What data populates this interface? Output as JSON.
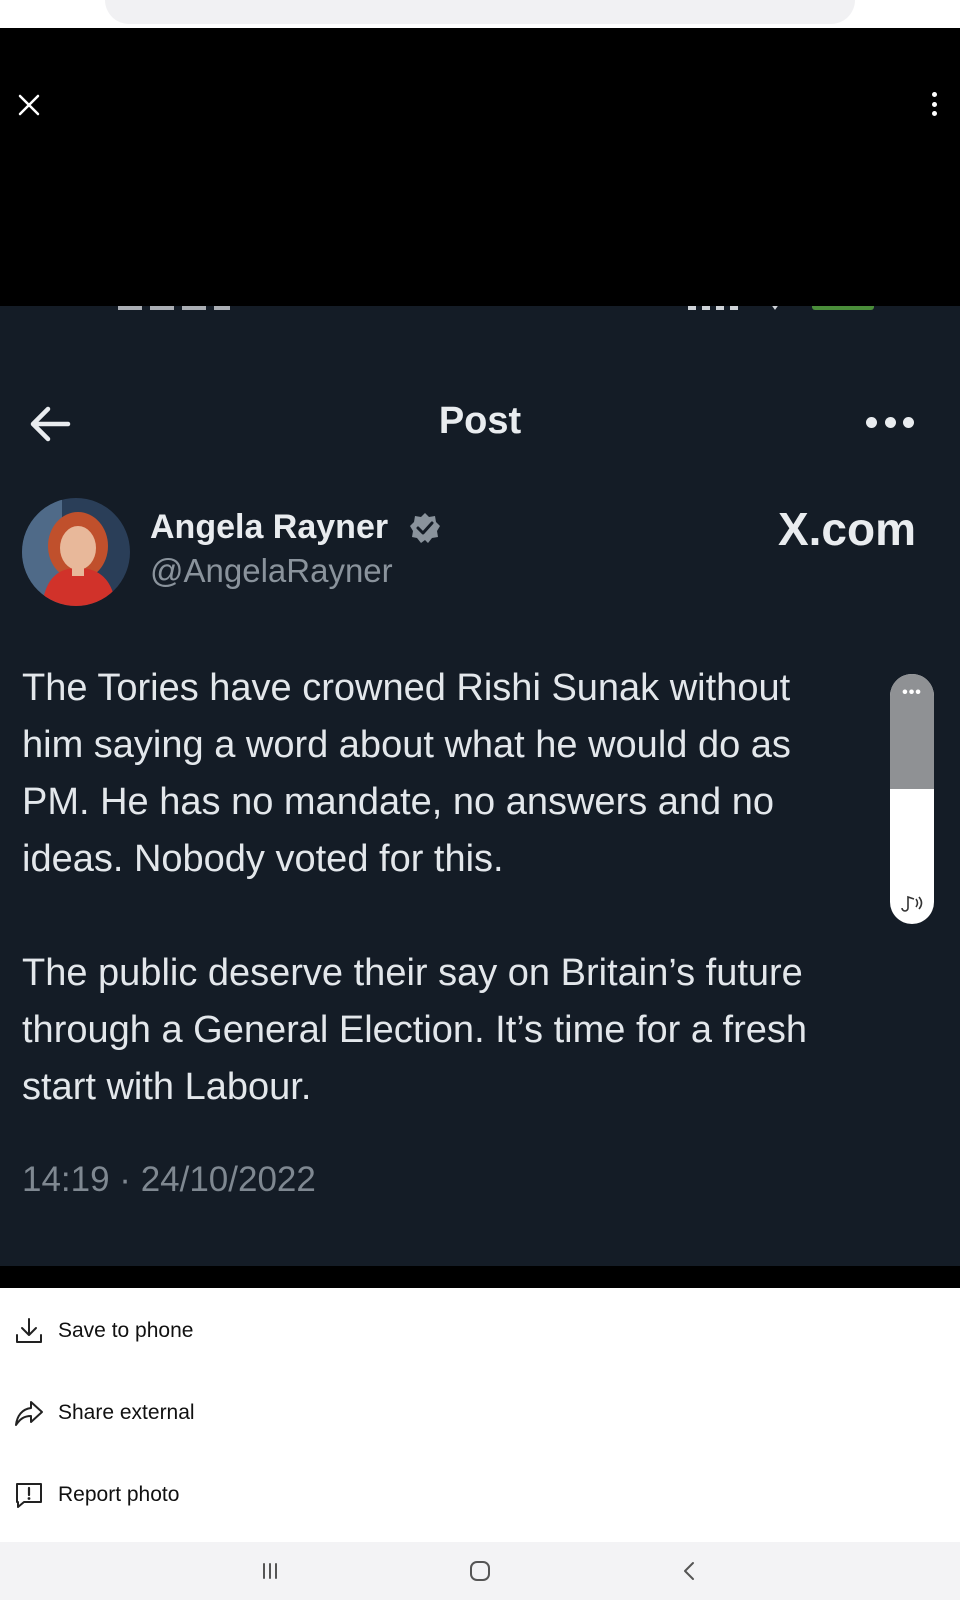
{
  "viewer": {
    "close_icon": "close-icon",
    "menu_icon": "more-vert-icon"
  },
  "post": {
    "title": "Post",
    "author_name": "Angela Rayner",
    "author_handle": "@AngelaRayner",
    "brand": "X.com",
    "paragraphs": [
      "The Tories have crowned Rishi Sunak without\nhim saying a word about what he would do as\nPM. He has no mandate, no answers and no\nideas. Nobody voted for this.",
      "The public deserve their say on Britain’s future\nthrough a General Election. It’s time for a fresh\nstart with Labour."
    ],
    "timestamp": "14:19 · 24/10/2022",
    "verified_color": "#8a939c"
  },
  "volume_overlay": {
    "level": 0.5,
    "menu_dots": "•••",
    "icon": "sound-icon"
  },
  "sheet": {
    "items": [
      {
        "label": "Save to phone",
        "icon": "download-icon"
      },
      {
        "label": "Share external",
        "icon": "share-icon"
      },
      {
        "label": "Report photo",
        "icon": "report-icon"
      }
    ]
  },
  "navbar": {
    "buttons": [
      "recent-apps-icon",
      "home-icon",
      "back-icon"
    ]
  }
}
